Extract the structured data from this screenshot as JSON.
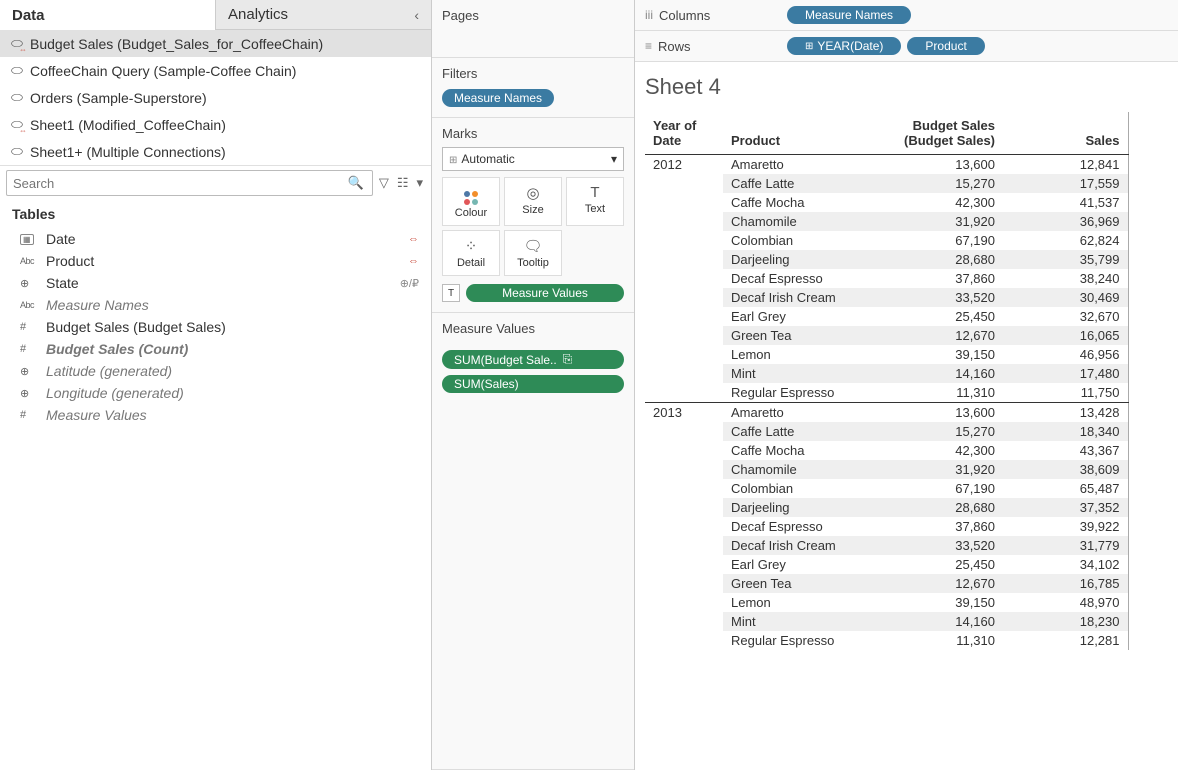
{
  "tabs": {
    "data": "Data",
    "analytics": "Analytics"
  },
  "datasources": [
    {
      "name": "Budget Sales (Budget_Sales_for_CoffeeChain)",
      "icon": "link",
      "selected": true
    },
    {
      "name": "CoffeeChain Query (Sample-Coffee Chain)",
      "icon": "db"
    },
    {
      "name": "Orders (Sample-Superstore)",
      "icon": "db"
    },
    {
      "name": "Sheet1 (Modified_CoffeeChain)",
      "icon": "dblink"
    },
    {
      "name": "Sheet1+ (Multiple Connections)",
      "icon": "db"
    }
  ],
  "search": {
    "placeholder": "Search"
  },
  "tables_header": "Tables",
  "fields": [
    {
      "icon": "date",
      "label": "Date",
      "link": true
    },
    {
      "icon": "abc",
      "label": "Product",
      "link": true
    },
    {
      "icon": "globe",
      "label": "State",
      "tag": "⊕/₽"
    },
    {
      "icon": "abc",
      "label": "Measure Names",
      "generated": true
    },
    {
      "icon": "hash",
      "label": "Budget Sales (Budget Sales)"
    },
    {
      "icon": "hash",
      "label": "Budget Sales (Count)",
      "generated": true,
      "italicbold": true
    },
    {
      "icon": "globe",
      "label": "Latitude (generated)",
      "generated": true
    },
    {
      "icon": "globe",
      "label": "Longitude (generated)",
      "generated": true
    },
    {
      "icon": "hash",
      "label": "Measure Values",
      "generated": true
    }
  ],
  "shelves": {
    "pages": "Pages",
    "filters": "Filters",
    "filter_pills": [
      "Measure Names"
    ],
    "marks": "Marks",
    "marks_type": "Automatic",
    "mark_cells": {
      "colour": "Colour",
      "size": "Size",
      "text": "Text",
      "detail": "Detail",
      "tooltip": "Tooltip"
    },
    "text_pill": "Measure Values",
    "mv_title": "Measure Values",
    "mv_pills": [
      "SUM(Budget Sale..",
      "SUM(Sales)"
    ]
  },
  "columns": {
    "label": "Columns",
    "pills": [
      "Measure Names"
    ]
  },
  "rows": {
    "label": "Rows",
    "pills": [
      "YEAR(Date)",
      "Product"
    ]
  },
  "sheet_title": "Sheet 4",
  "table": {
    "headers": {
      "year": "Year of Date",
      "product": "Product",
      "budget": "Budget Sales (Budget Sales)",
      "sales": "Sales"
    }
  },
  "chart_data": {
    "type": "table",
    "columns": [
      "Year of Date",
      "Product",
      "Budget Sales (Budget Sales)",
      "Sales"
    ],
    "rows": [
      {
        "year": "2012",
        "product": "Amaretto",
        "budget": "13,600",
        "sales": "12,841"
      },
      {
        "year": "2012",
        "product": "Caffe Latte",
        "budget": "15,270",
        "sales": "17,559"
      },
      {
        "year": "2012",
        "product": "Caffe Mocha",
        "budget": "42,300",
        "sales": "41,537"
      },
      {
        "year": "2012",
        "product": "Chamomile",
        "budget": "31,920",
        "sales": "36,969"
      },
      {
        "year": "2012",
        "product": "Colombian",
        "budget": "67,190",
        "sales": "62,824"
      },
      {
        "year": "2012",
        "product": "Darjeeling",
        "budget": "28,680",
        "sales": "35,799"
      },
      {
        "year": "2012",
        "product": "Decaf Espresso",
        "budget": "37,860",
        "sales": "38,240"
      },
      {
        "year": "2012",
        "product": "Decaf Irish Cream",
        "budget": "33,520",
        "sales": "30,469"
      },
      {
        "year": "2012",
        "product": "Earl Grey",
        "budget": "25,450",
        "sales": "32,670"
      },
      {
        "year": "2012",
        "product": "Green Tea",
        "budget": "12,670",
        "sales": "16,065"
      },
      {
        "year": "2012",
        "product": "Lemon",
        "budget": "39,150",
        "sales": "46,956"
      },
      {
        "year": "2012",
        "product": "Mint",
        "budget": "14,160",
        "sales": "17,480"
      },
      {
        "year": "2012",
        "product": "Regular Espresso",
        "budget": "11,310",
        "sales": "11,750"
      },
      {
        "year": "2013",
        "product": "Amaretto",
        "budget": "13,600",
        "sales": "13,428"
      },
      {
        "year": "2013",
        "product": "Caffe Latte",
        "budget": "15,270",
        "sales": "18,340"
      },
      {
        "year": "2013",
        "product": "Caffe Mocha",
        "budget": "42,300",
        "sales": "43,367"
      },
      {
        "year": "2013",
        "product": "Chamomile",
        "budget": "31,920",
        "sales": "38,609"
      },
      {
        "year": "2013",
        "product": "Colombian",
        "budget": "67,190",
        "sales": "65,487"
      },
      {
        "year": "2013",
        "product": "Darjeeling",
        "budget": "28,680",
        "sales": "37,352"
      },
      {
        "year": "2013",
        "product": "Decaf Espresso",
        "budget": "37,860",
        "sales": "39,922"
      },
      {
        "year": "2013",
        "product": "Decaf Irish Cream",
        "budget": "33,520",
        "sales": "31,779"
      },
      {
        "year": "2013",
        "product": "Earl Grey",
        "budget": "25,450",
        "sales": "34,102"
      },
      {
        "year": "2013",
        "product": "Green Tea",
        "budget": "12,670",
        "sales": "16,785"
      },
      {
        "year": "2013",
        "product": "Lemon",
        "budget": "39,150",
        "sales": "48,970"
      },
      {
        "year": "2013",
        "product": "Mint",
        "budget": "14,160",
        "sales": "18,230"
      },
      {
        "year": "2013",
        "product": "Regular Espresso",
        "budget": "11,310",
        "sales": "12,281"
      }
    ]
  }
}
